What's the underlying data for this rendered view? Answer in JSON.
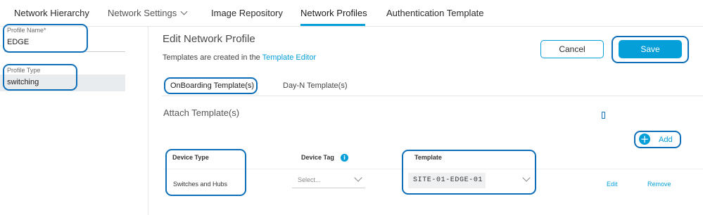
{
  "nav": {
    "tabs": [
      {
        "label": "Network Hierarchy"
      },
      {
        "label": "Network Settings"
      },
      {
        "label": "Image Repository"
      },
      {
        "label": "Network Profiles"
      },
      {
        "label": "Authentication Template"
      }
    ],
    "active_tab": "Network Profiles"
  },
  "left": {
    "profile_name_label": "Profile Name*",
    "profile_name_value": "EDGE",
    "profile_type_label": "Profile Type",
    "profile_type_value": "switching"
  },
  "main": {
    "title": "Edit Network Profile",
    "subtext_prefix": "Templates are created in the",
    "subtext_link": "Template Editor",
    "cancel_label": "Cancel",
    "save_label": "Save",
    "subtabs": [
      {
        "label": "OnBoarding Template(s)"
      },
      {
        "label": "Day-N Template(s)"
      }
    ],
    "attach_title": "Attach Template(s)",
    "add_label": "Add",
    "table": {
      "headers": {
        "device_type": "Device Type",
        "device_tag": "Device Tag",
        "template": "Template"
      },
      "rows": [
        {
          "device_type": "Switches and Hubs",
          "device_tag_placeholder": "Select...",
          "template": "SITE-01-EDGE-01",
          "edit_label": "Edit",
          "remove_label": "Remove"
        }
      ]
    }
  },
  "icons": {
    "chevron": "chevron-down-icon",
    "add": "plus-circle-icon",
    "info": "info-icon"
  },
  "colors": {
    "accent": "#049fd9",
    "callout": "#0e6fb8"
  }
}
